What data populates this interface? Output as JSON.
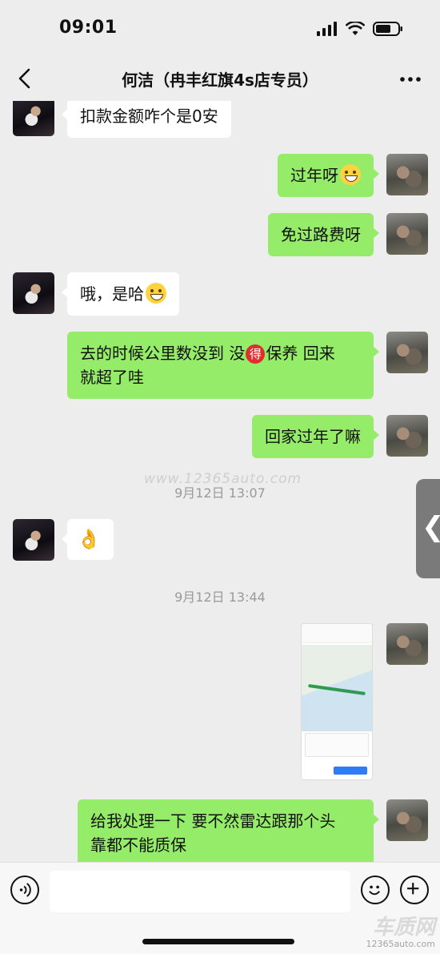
{
  "status_bar": {
    "time": "09:01"
  },
  "nav": {
    "title": "何洁（冉丰红旗4s店专员）"
  },
  "messages": [
    {
      "side": "left",
      "text": "扣款金额咋个是0安"
    },
    {
      "side": "right",
      "text": "过年呀",
      "emoji": "laughing-tears"
    },
    {
      "side": "right",
      "text": "免过路费呀"
    },
    {
      "side": "left",
      "text": "哦，是哈",
      "emoji": "grinning"
    },
    {
      "side": "right",
      "text_before": "去的时候公里数没到 没",
      "badge": "得",
      "text_after": "保养 回来",
      "text_line2": "就超了哇"
    },
    {
      "side": "right",
      "text": "回家过年了嘛"
    },
    {
      "side": "left",
      "emoji": "ok-hand",
      "text": "👌"
    },
    {
      "side": "right",
      "type": "image",
      "image_desc": "map-navigation-screenshot"
    },
    {
      "side": "right",
      "text_line1": "给我处理一下 要不然雷达跟那个头",
      "text_line2": "靠都不能质保"
    }
  ],
  "timestamps": [
    "9月12日 13:07",
    "9月12日 13:44"
  ],
  "watermark": "www.12365auto.com",
  "corner_logo": {
    "main": "车质网",
    "sub": "12365auto.com"
  },
  "colors": {
    "outgoing_bubble": "#95ec69",
    "incoming_bubble": "#ffffff",
    "background": "#ededed"
  }
}
